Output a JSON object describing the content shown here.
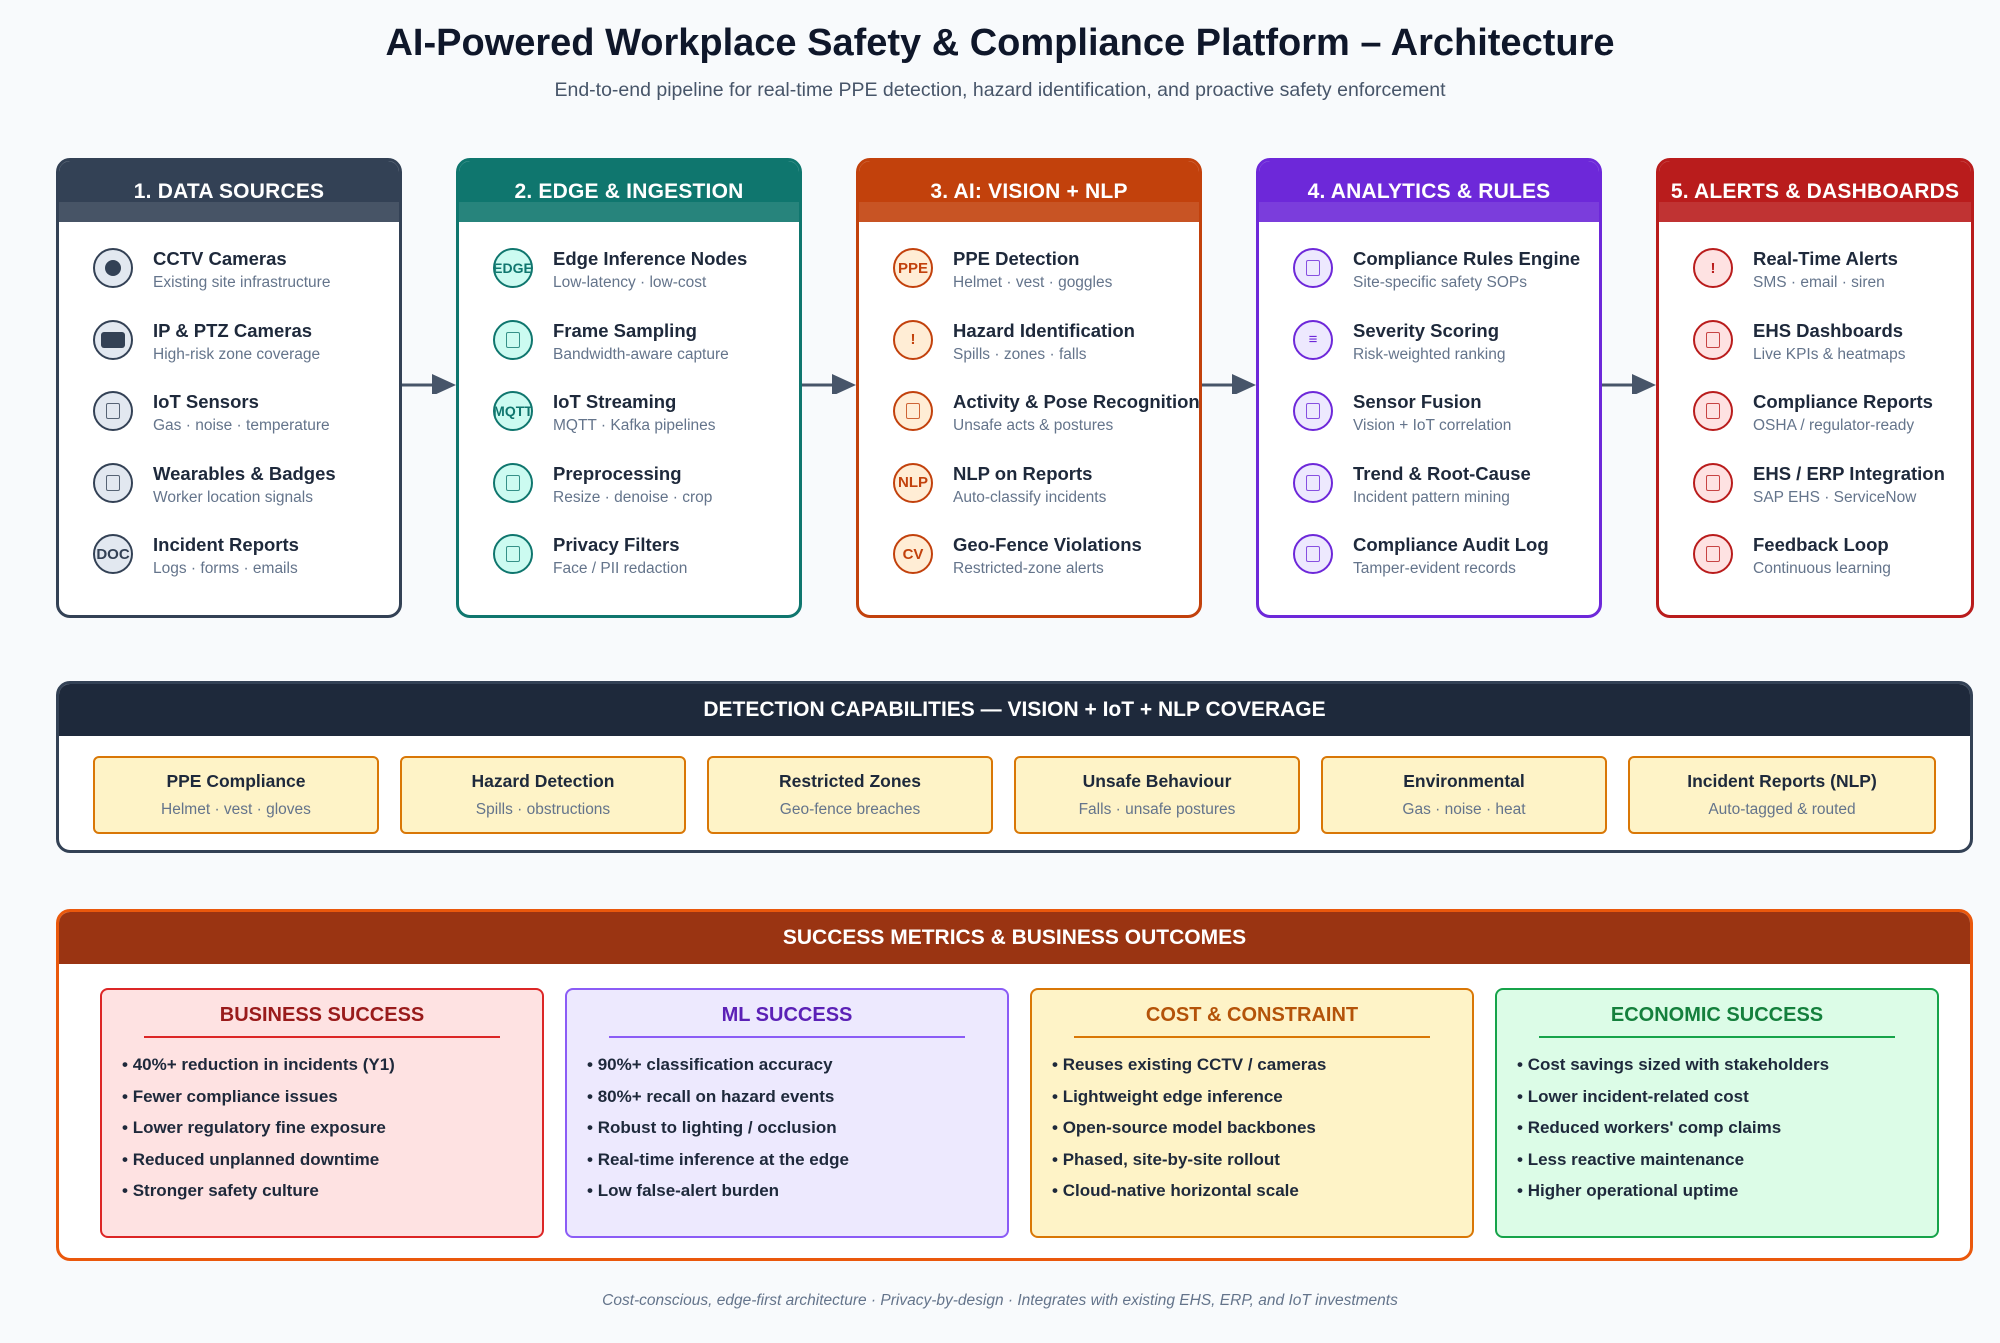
{
  "title": "AI-Powered Workplace Safety & Compliance Platform – Architecture",
  "subtitle": "End-to-end pipeline for real-time PPE detection, hazard identification, and proactive safety enforcement",
  "stages": [
    {
      "header": "1. DATA SOURCES",
      "color": "#334155",
      "icon_bg": "#e2e8f0",
      "items": [
        {
          "title": "CCTV Cameras",
          "sub": "Existing site infrastructure",
          "icon": "camera-icon",
          "glyph": "●"
        },
        {
          "title": "IP & PTZ Cameras",
          "sub": "High-risk zone coverage",
          "icon": "ptz-camera-icon",
          "glyph": "▬"
        },
        {
          "title": "IoT Sensors",
          "sub": "Gas · noise · temperature",
          "icon": "sensor-icon",
          "glyph": ""
        },
        {
          "title": "Wearables & Badges",
          "sub": "Worker location signals",
          "icon": "badge-icon",
          "glyph": ""
        },
        {
          "title": "Incident Reports",
          "sub": "Logs · forms · emails",
          "icon": "document-icon",
          "glyph": "DOC"
        }
      ]
    },
    {
      "header": "2. EDGE & INGESTION",
      "color": "#0f766e",
      "icon_bg": "#ccfbf1",
      "items": [
        {
          "title": "Edge Inference Nodes",
          "sub": "Low-latency · low-cost",
          "icon": "edge-icon",
          "glyph": "EDGE"
        },
        {
          "title": "Frame Sampling",
          "sub": "Bandwidth-aware capture",
          "icon": "frame-icon",
          "glyph": ""
        },
        {
          "title": "IoT Streaming",
          "sub": "MQTT · Kafka pipelines",
          "icon": "stream-icon",
          "glyph": "MQTT"
        },
        {
          "title": "Preprocessing",
          "sub": "Resize · denoise · crop",
          "icon": "preprocess-icon",
          "glyph": ""
        },
        {
          "title": "Privacy Filters",
          "sub": "Face / PII redaction",
          "icon": "privacy-icon",
          "glyph": ""
        }
      ]
    },
    {
      "header": "3. AI: VISION + NLP",
      "color": "#c2410c",
      "icon_bg": "#ffedd5",
      "items": [
        {
          "title": "PPE Detection",
          "sub": "Helmet · vest · goggles",
          "icon": "ppe-icon",
          "glyph": "PPE"
        },
        {
          "title": "Hazard Identification",
          "sub": "Spills · zones · falls",
          "icon": "warning-icon",
          "glyph": "!"
        },
        {
          "title": "Activity & Pose Recognition",
          "sub": "Unsafe acts & postures",
          "icon": "pose-icon",
          "glyph": ""
        },
        {
          "title": "NLP on Reports",
          "sub": "Auto-classify incidents",
          "icon": "nlp-icon",
          "glyph": "NLP"
        },
        {
          "title": "Geo-Fence Violations",
          "sub": "Restricted-zone alerts",
          "icon": "cv-icon",
          "glyph": "CV"
        }
      ]
    },
    {
      "header": "4. ANALYTICS & RULES",
      "color": "#6d28d9",
      "icon_bg": "#ede9fe",
      "items": [
        {
          "title": "Compliance Rules Engine",
          "sub": "Site-specific safety SOPs",
          "icon": "rules-icon",
          "glyph": ""
        },
        {
          "title": "Severity Scoring",
          "sub": "Risk-weighted ranking",
          "icon": "list-icon",
          "glyph": "≡"
        },
        {
          "title": "Sensor Fusion",
          "sub": "Vision + IoT correlation",
          "icon": "fusion-icon",
          "glyph": ""
        },
        {
          "title": "Trend & Root-Cause",
          "sub": "Incident pattern mining",
          "icon": "trend-icon",
          "glyph": ""
        },
        {
          "title": "Compliance Audit Log",
          "sub": "Tamper-evident records",
          "icon": "audit-icon",
          "glyph": ""
        }
      ]
    },
    {
      "header": "5. ALERTS & DASHBOARDS",
      "color": "#b91c1c",
      "icon_bg": "#fee2e2",
      "items": [
        {
          "title": "Real-Time Alerts",
          "sub": "SMS · email · siren",
          "icon": "alert-icon",
          "glyph": "!"
        },
        {
          "title": "EHS Dashboards",
          "sub": "Live KPIs & heatmaps",
          "icon": "dashboard-icon",
          "glyph": ""
        },
        {
          "title": "Compliance Reports",
          "sub": "OSHA / regulator-ready",
          "icon": "report-icon",
          "glyph": ""
        },
        {
          "title": "EHS / ERP Integration",
          "sub": "SAP EHS · ServiceNow",
          "icon": "integration-icon",
          "glyph": ""
        },
        {
          "title": "Feedback Loop",
          "sub": "Continuous learning",
          "icon": "feedback-icon",
          "glyph": ""
        }
      ]
    }
  ],
  "detection": {
    "header": "DETECTION CAPABILITIES — VISION + IoT + NLP COVERAGE",
    "items": [
      {
        "title": "PPE Compliance",
        "sub": "Helmet · vest · gloves"
      },
      {
        "title": "Hazard Detection",
        "sub": "Spills · obstructions"
      },
      {
        "title": "Restricted Zones",
        "sub": "Geo-fence breaches"
      },
      {
        "title": "Unsafe Behaviour",
        "sub": "Falls · unsafe postures"
      },
      {
        "title": "Environmental",
        "sub": "Gas · noise · heat"
      },
      {
        "title": "Incident Reports (NLP)",
        "sub": "Auto-tagged & routed"
      }
    ]
  },
  "metrics": {
    "header": "SUCCESS METRICS & BUSINESS OUTCOMES",
    "cards": [
      {
        "title": "BUSINESS SUCCESS",
        "color": "#991b1b",
        "bg": "#fee2e2",
        "border": "#dc2626",
        "items": [
          "40%+ reduction in incidents (Y1)",
          "Fewer compliance issues",
          "Lower regulatory fine exposure",
          "Reduced unplanned downtime",
          "Stronger safety culture"
        ]
      },
      {
        "title": "ML SUCCESS",
        "color": "#5b21b6",
        "bg": "#ede9fe",
        "border": "#8b5cf6",
        "items": [
          "90%+ classification accuracy",
          "80%+ recall on hazard events",
          "Robust to lighting / occlusion",
          "Real-time inference at the edge",
          "Low false-alert burden"
        ]
      },
      {
        "title": "COST & CONSTRAINT",
        "color": "#b45309",
        "bg": "#fef3c7",
        "border": "#d97706",
        "items": [
          "Reuses existing CCTV / cameras",
          "Lightweight edge inference",
          "Open-source model backbones",
          "Phased, site-by-site rollout",
          "Cloud-native horizontal scale"
        ]
      },
      {
        "title": "ECONOMIC SUCCESS",
        "color": "#15803d",
        "bg": "#dcfce7",
        "border": "#16a34a",
        "items": [
          "Cost savings sized with stakeholders",
          "Lower incident-related cost",
          "Reduced workers' comp claims",
          "Less reactive maintenance",
          "Higher operational uptime"
        ]
      }
    ]
  },
  "footer": "Cost-conscious, edge-first architecture · Privacy-by-design · Integrates with existing EHS, ERP, and IoT investments"
}
